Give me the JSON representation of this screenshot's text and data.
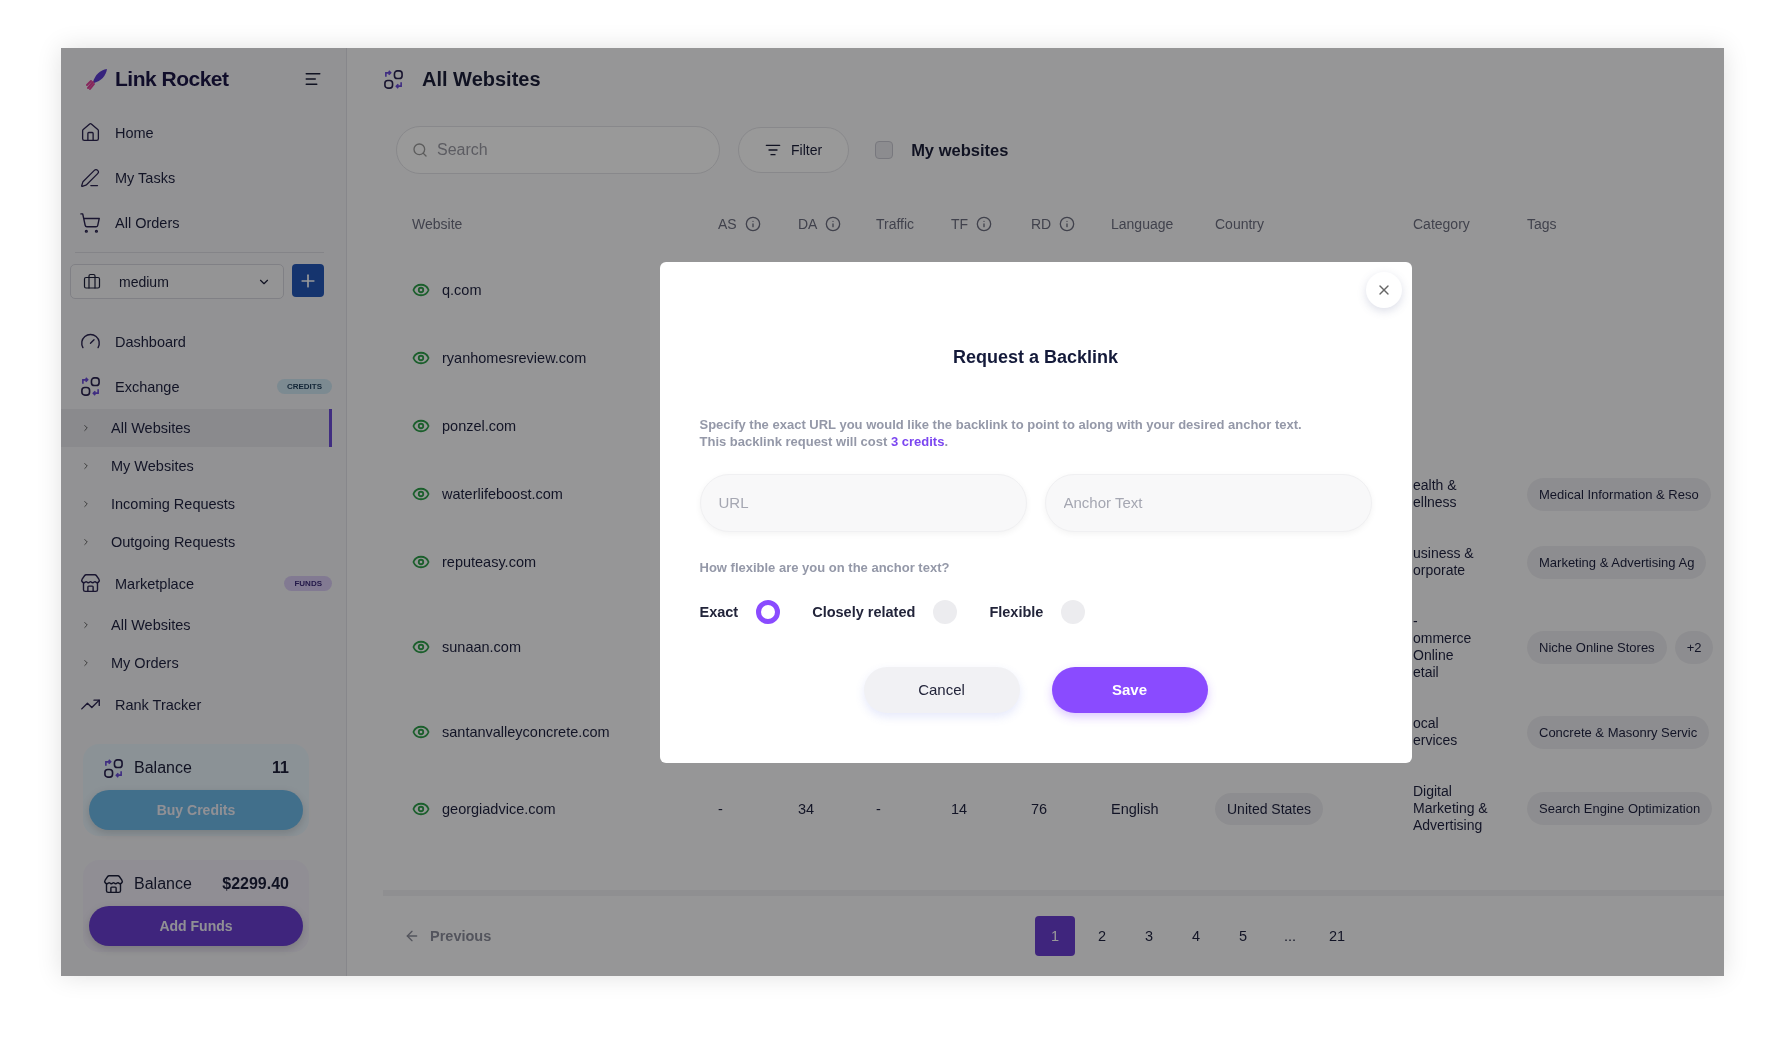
{
  "brand": {
    "name": "Link Rocket"
  },
  "sidebar": {
    "top_items": [
      {
        "label": "Home"
      },
      {
        "label": "My Tasks"
      },
      {
        "label": "All Orders"
      }
    ],
    "workspace": {
      "value": "medium"
    },
    "sections": [
      {
        "label": "Dashboard"
      },
      {
        "label": "Exchange",
        "badge": {
          "kind": "credits",
          "label": "CREDITS"
        },
        "children": [
          {
            "label": "All Websites",
            "selected": true
          },
          {
            "label": "My Websites",
            "selected": false
          },
          {
            "label": "Incoming Requests",
            "selected": false
          },
          {
            "label": "Outgoing Requests",
            "selected": false
          }
        ]
      },
      {
        "label": "Marketplace",
        "badge": {
          "kind": "funds",
          "label": "FUNDS"
        },
        "children": [
          {
            "label": "All Websites",
            "selected": false
          },
          {
            "label": "My Orders",
            "selected": false
          }
        ]
      },
      {
        "label": "Rank Tracker"
      }
    ],
    "balances": [
      {
        "kind": "credits",
        "label": "Balance",
        "amount": "11",
        "button": "Buy Credits"
      },
      {
        "kind": "funds",
        "label": "Balance",
        "amount": "$2299.40",
        "button": "Add Funds"
      }
    ]
  },
  "main": {
    "title": "All Websites",
    "search": {
      "placeholder": "Search"
    },
    "filter": {
      "label": "Filter"
    },
    "my_websites": {
      "label": "My websites",
      "checked": false
    }
  },
  "table": {
    "columns": [
      {
        "label": "Website",
        "info": false
      },
      {
        "label": "AS",
        "info": true
      },
      {
        "label": "DA",
        "info": true
      },
      {
        "label": "Traffic",
        "info": false
      },
      {
        "label": "TF",
        "info": true
      },
      {
        "label": "RD",
        "info": true
      },
      {
        "label": "Language",
        "info": false
      },
      {
        "label": "Country",
        "info": false
      },
      {
        "label": "Category",
        "info": false
      },
      {
        "label": "Tags",
        "info": false
      }
    ],
    "rows": [
      {
        "website": "q.com"
      },
      {
        "website": "ryanhomesreview.com"
      },
      {
        "website": "ponzel.com"
      },
      {
        "website": "waterlifeboost.com",
        "category": "ealth &\nellness",
        "tags": [
          "Medical Information & Reso"
        ]
      },
      {
        "website": "reputeasy.com",
        "category": "usiness &\norporate",
        "tags": [
          "Marketing & Advertising Ag"
        ]
      },
      {
        "website": "sunaan.com",
        "category": "-\nommerce\nOnline\netail",
        "tags": [
          "Niche Online Stores",
          "+2"
        ]
      },
      {
        "website": "santanvalleyconcrete.com",
        "category": "ocal\nervices",
        "tags": [
          "Concrete & Masonry Servic"
        ]
      },
      {
        "website": "georgiadvice.com",
        "cells": [
          "-",
          "34",
          "-",
          "14",
          "76",
          "English"
        ],
        "country": "United States",
        "category": "Digital Marketing & Advertising",
        "tags": [
          "Search Engine Optimization"
        ]
      }
    ]
  },
  "pagination": {
    "previous": "Previous",
    "pages": [
      {
        "label": "1",
        "selected": true
      },
      {
        "label": "2",
        "selected": false
      },
      {
        "label": "3",
        "selected": false
      },
      {
        "label": "4",
        "selected": false
      },
      {
        "label": "5",
        "selected": false
      },
      {
        "label": "...",
        "selected": false
      },
      {
        "label": "21",
        "selected": false
      }
    ]
  },
  "modal": {
    "title": "Request a Backlink",
    "description": "Specify the exact URL you would like the backlink to point to along with your desired anchor text.",
    "cost_text": "This backlink request will cost ",
    "cost_link": "3 credits",
    "cost_suffix": ".",
    "fields": [
      {
        "placeholder": "URL"
      },
      {
        "placeholder": "Anchor Text"
      }
    ],
    "question": "How flexible are you on the anchor text?",
    "options": [
      {
        "label": "Exact",
        "selected": true
      },
      {
        "label": "Closely related",
        "selected": false
      },
      {
        "label": "Flexible",
        "selected": false
      }
    ],
    "buttons": [
      {
        "kind": "secondary",
        "label": "Cancel"
      },
      {
        "kind": "primary",
        "label": "Save"
      }
    ]
  }
}
